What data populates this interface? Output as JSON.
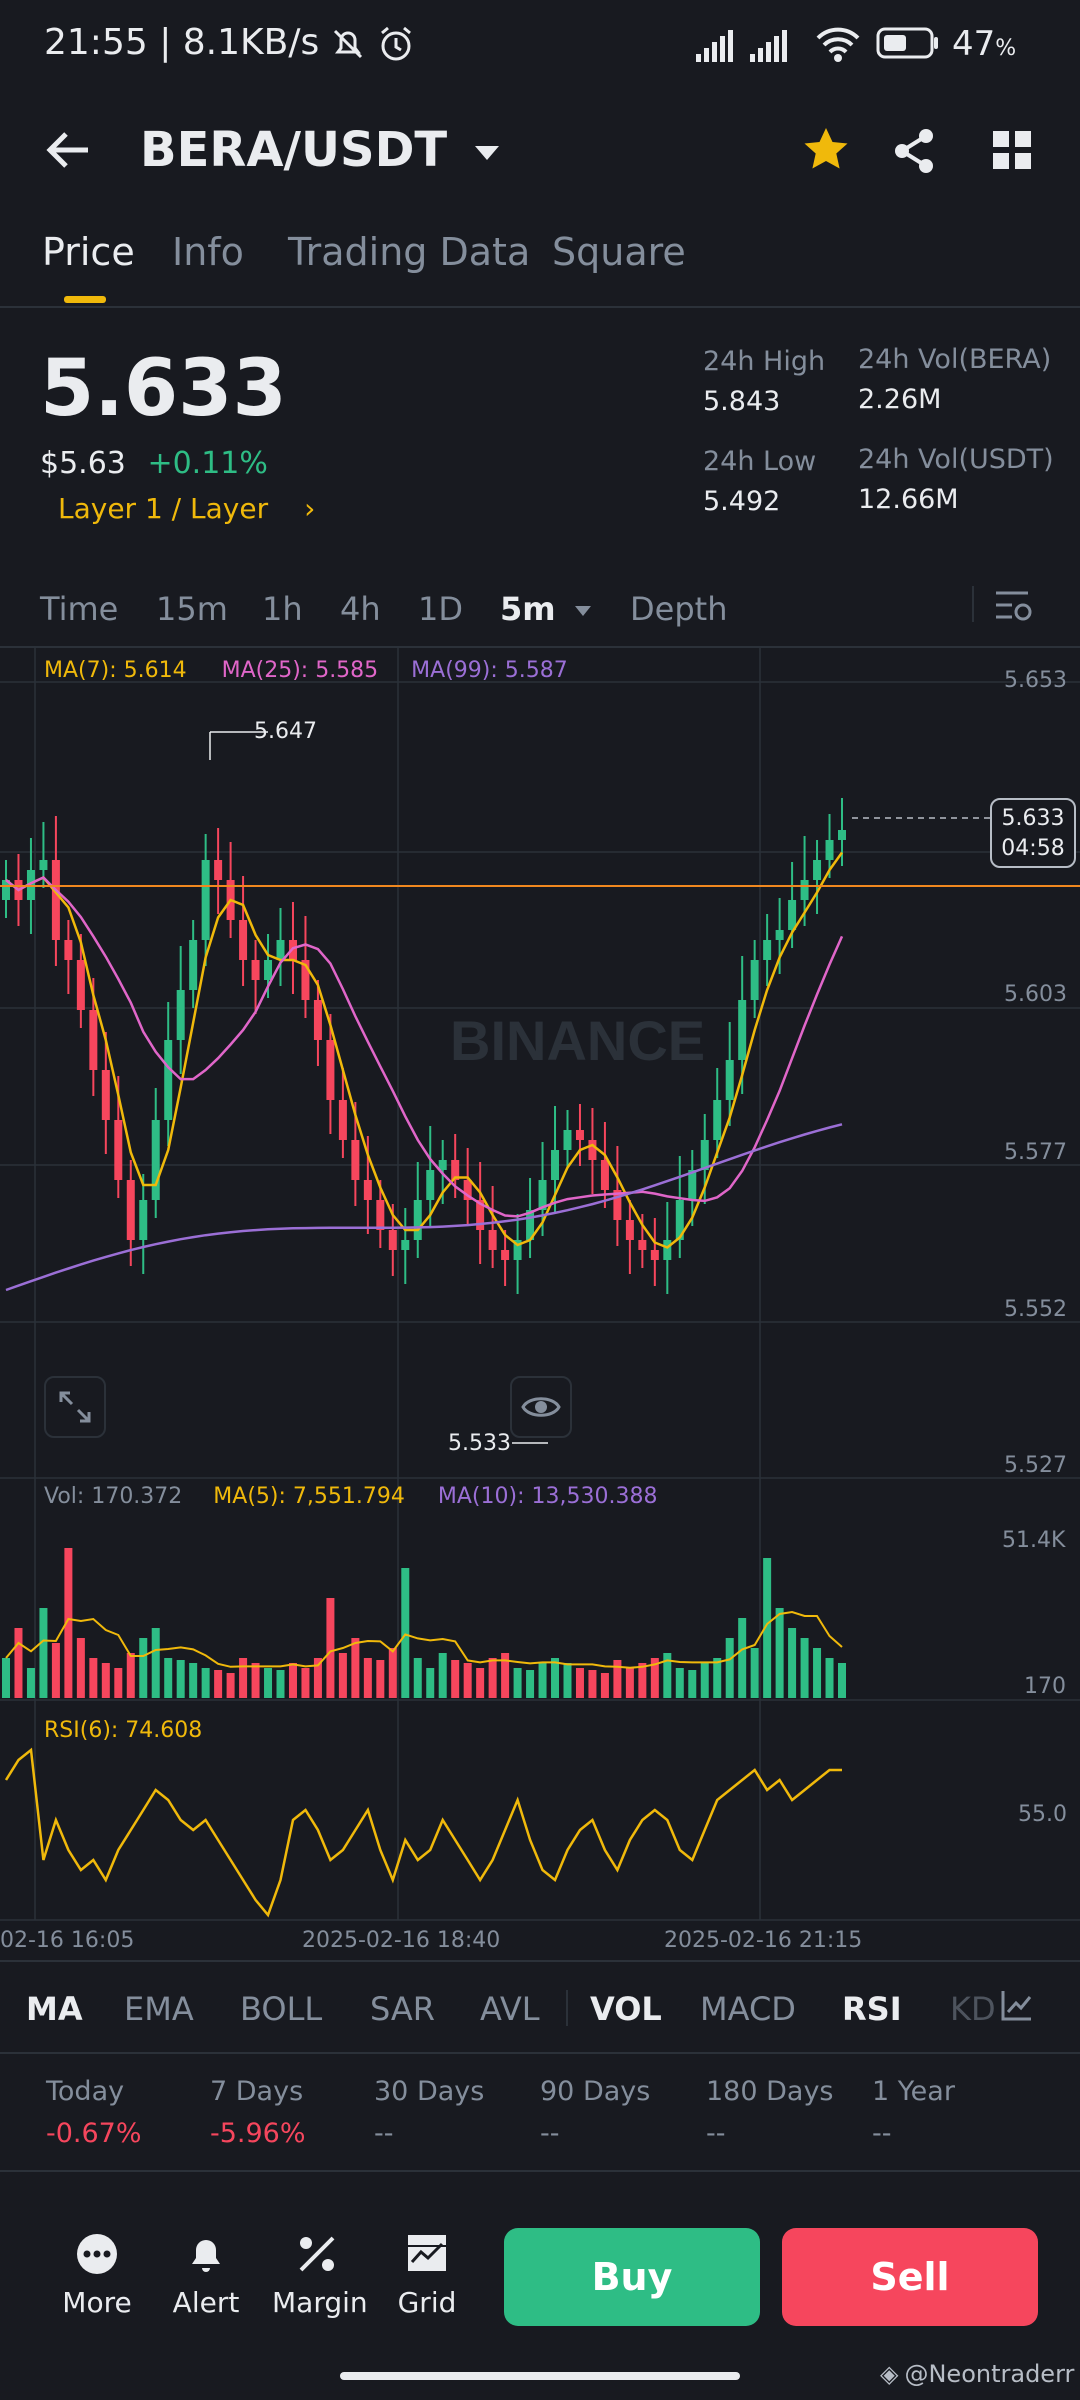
{
  "status": {
    "time": "21:55",
    "speed": "8.1KB/s",
    "battery": "47",
    "battery_unit": "%"
  },
  "header": {
    "pair": "BERA/USDT"
  },
  "tabs": [
    {
      "label": "Price"
    },
    {
      "label": "Info"
    },
    {
      "label": "Trading Data"
    },
    {
      "label": "Square"
    }
  ],
  "price": {
    "last": "5.633",
    "usd": "$5.63",
    "change": "+0.11%",
    "category": "Layer 1 / Layer",
    "category_arrow": "›"
  },
  "stats": {
    "high_label": "24h High",
    "high": "5.843",
    "vol_base_label": "24h Vol(BERA)",
    "vol_base": "2.26M",
    "low_label": "24h Low",
    "low": "5.492",
    "vol_quote_label": "24h Vol(USDT)",
    "vol_quote": "12.66M"
  },
  "intervals": [
    {
      "label": "Time"
    },
    {
      "label": "15m"
    },
    {
      "label": "1h"
    },
    {
      "label": "4h"
    },
    {
      "label": "1D"
    },
    {
      "label": "5m"
    },
    {
      "label": "Depth"
    }
  ],
  "chart": {
    "ma7": "MA(7): 5.614",
    "ma25": "MA(25): 5.585",
    "ma99": "MA(99): 5.587",
    "y_ticks": [
      "5.653",
      "5.603",
      "5.577",
      "5.552",
      "5.527"
    ],
    "high_marker": "5.647",
    "low_marker": "5.533",
    "price_tag": "5.633",
    "countdown": "04:58",
    "watermark": "BINANCE",
    "vol_label": "Vol: 170.372",
    "vol_ma5": "MA(5): 7,551.794",
    "vol_ma10": "MA(10): 13,530.388",
    "vol_ticks": [
      "51.4K",
      "170"
    ],
    "rsi_label": "RSI(6): 74.608",
    "rsi_tick": "55.0",
    "x_labels": [
      "02-16 16:05",
      "2025-02-16 18:40",
      "2025-02-16 21:15"
    ],
    "colors": {
      "up": "#2ebd85",
      "down": "#f6465d",
      "ma7": "#f0b90b",
      "ma25": "#e066c9",
      "ma99": "#9b6fd6"
    }
  },
  "indicators": [
    {
      "label": "MA"
    },
    {
      "label": "EMA"
    },
    {
      "label": "BOLL"
    },
    {
      "label": "SAR"
    },
    {
      "label": "AVL"
    },
    {
      "label": "VOL"
    },
    {
      "label": "MACD"
    },
    {
      "label": "RSI"
    },
    {
      "label": "KD"
    }
  ],
  "perf": [
    {
      "label": "Today",
      "value": "-0.67%"
    },
    {
      "label": "7 Days",
      "value": "-5.96%"
    },
    {
      "label": "30 Days",
      "value": "--"
    },
    {
      "label": "90 Days",
      "value": "--"
    },
    {
      "label": "180 Days",
      "value": "--"
    },
    {
      "label": "1 Year",
      "value": "--"
    }
  ],
  "bottom": {
    "more": "More",
    "alert": "Alert",
    "margin": "Margin",
    "grid": "Grid",
    "buy": "Buy",
    "sell": "Sell",
    "credit": "@Neontraderr"
  }
}
